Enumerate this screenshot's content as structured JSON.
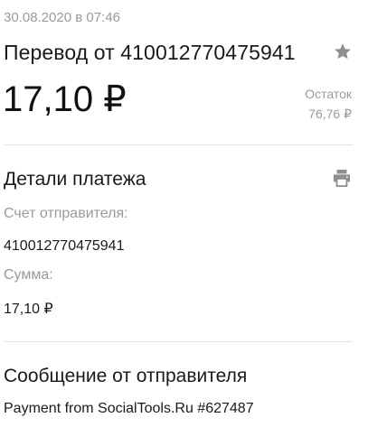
{
  "header": {
    "timestamp": "30.08.2020 в 07:46",
    "title": "Перевод от 410012770475941",
    "star_icon": "star-icon",
    "amount": "17,10 ₽",
    "balance_label": "Остаток",
    "balance_value": "76,76 ₽"
  },
  "details": {
    "title": "Детали платежа",
    "print_icon": "printer-icon",
    "sender_account_label": "Счет отправителя:",
    "sender_account_value": "410012770475941",
    "sum_label": "Сумма:",
    "sum_value": "17,10 ₽"
  },
  "message": {
    "title": "Сообщение от отправителя",
    "text": "Payment from SocialTools.Ru #627487"
  },
  "colors": {
    "muted_text": "#9a9a9a",
    "primary_text": "#1a1a1a",
    "divider": "#e3e3e3",
    "icon": "#8f8f8f"
  }
}
